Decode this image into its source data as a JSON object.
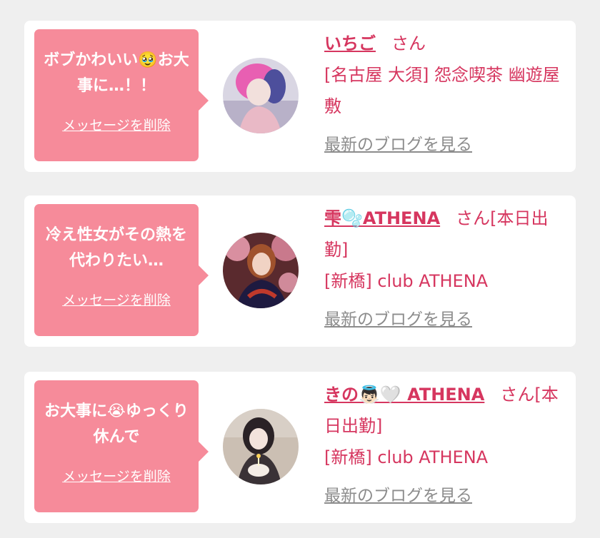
{
  "cards": [
    {
      "message": "ボブかわいい🥹お大事に…！！",
      "delete_label": "メッセージを削除",
      "name": "いちご",
      "suffix": "さん",
      "shop": "[名古屋 大須] 怨念喫茶 幽遊屋敷",
      "blog_label": "最新のブログを見る"
    },
    {
      "message": "冷え性女がその熱を代わりたい…",
      "delete_label": "メッセージを削除",
      "name": "雫🫧ATHENA",
      "suffix": "さん[本日出勤]",
      "shop": "[新橋] club ATHENA",
      "blog_label": "最新のブログを見る"
    },
    {
      "message": "お大事に😭ゆっくり休んで",
      "delete_label": "メッセージを削除",
      "name": "きの👼🏻🤍 ATHENA",
      "suffix": "さん[本日出勤]",
      "shop": "[新橋] club ATHENA",
      "blog_label": "最新のブログを見る"
    }
  ],
  "colors": {
    "accent": "#d6365f",
    "bubble": "#f68b9a",
    "link_gray": "#8c8c8c",
    "background": "#efefef"
  }
}
